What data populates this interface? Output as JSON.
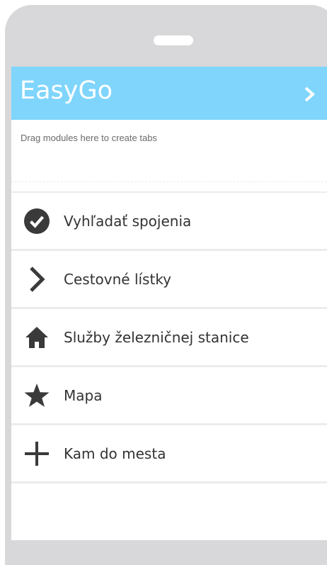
{
  "app": {
    "title": "EasyGo"
  },
  "tabs_area": {
    "hint": "Drag modules here to create tabs"
  },
  "menu": {
    "items": [
      {
        "label": "Vyhľadať spojenia",
        "icon": "check-circle-icon"
      },
      {
        "label": "Cestovné lístky",
        "icon": "chevron-right-icon"
      },
      {
        "label": "Služby železničnej stanice",
        "icon": "home-icon"
      },
      {
        "label": "Mapa",
        "icon": "star-icon"
      },
      {
        "label": "Kam do mesta",
        "icon": "plus-icon"
      }
    ]
  },
  "colors": {
    "header_bg": "#7fd5fc",
    "icon": "#3a3a3a",
    "frame": "#d8d8da"
  }
}
